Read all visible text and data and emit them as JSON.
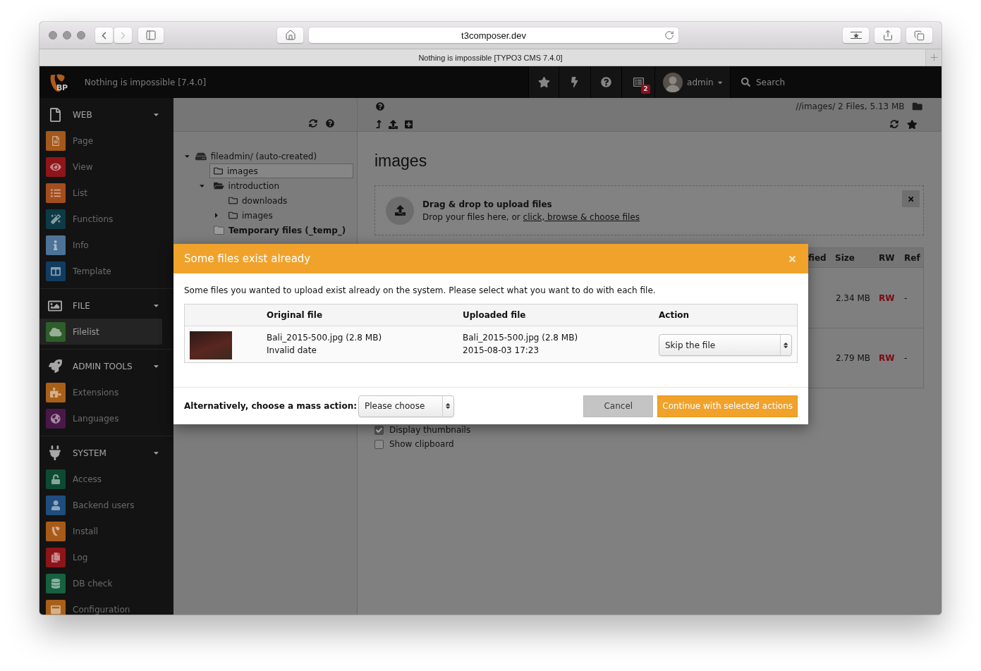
{
  "browser": {
    "navigation": [
      {
        "kind": "back",
        "disabled": false
      },
      {
        "kind": "forward",
        "disabled": true
      }
    ],
    "url": "t3composer.dev",
    "tab_title": "Nothing is impossible [TYPO3 CMS 7.4.0]"
  },
  "topbar": {
    "logo_text": "BP",
    "site_title": "Nothing is impossible [7.4.0]",
    "notification_count": "2",
    "user": "admin",
    "search": {
      "placeholder": "Search"
    }
  },
  "sidebar": {
    "groups": [
      {
        "title": "WEB",
        "expanded": true,
        "items": [
          {
            "label": "Page",
            "color": "#a4581c",
            "selected": false
          },
          {
            "label": "View",
            "color": "#8e1519",
            "selected": false
          },
          {
            "label": "List",
            "color": "#a24e1e",
            "selected": false
          },
          {
            "label": "Functions",
            "color": "#0c3b45",
            "selected": false
          },
          {
            "label": "Info",
            "color": "#4d7396",
            "selected": false
          },
          {
            "label": "Template",
            "color": "#113c60",
            "selected": false
          }
        ]
      },
      {
        "title": "FILE",
        "expanded": true,
        "items": [
          {
            "label": "Filelist",
            "color": "#2e5e2a",
            "selected": true
          }
        ]
      },
      {
        "title": "ADMIN TOOLS",
        "expanded": true,
        "items": [
          {
            "label": "Extensions",
            "color": "#a86018",
            "selected": false
          },
          {
            "label": "Languages",
            "color": "#4a1848",
            "selected": false
          }
        ]
      },
      {
        "title": "SYSTEM",
        "expanded": true,
        "items": [
          {
            "label": "Access",
            "color": "#0e4a32",
            "selected": false
          },
          {
            "label": "Backend users",
            "color": "#1f4d7d",
            "selected": false
          },
          {
            "label": "Install",
            "color": "#a85a18",
            "selected": false
          },
          {
            "label": "Log",
            "color": "#8e1418",
            "selected": false
          },
          {
            "label": "DB check",
            "color": "#176040",
            "selected": false
          },
          {
            "label": "Configuration",
            "color": "#a86018",
            "selected": false
          }
        ]
      }
    ]
  },
  "folder_tree": {
    "nodes": [
      {
        "label": "fileadmin/ (auto-created)",
        "kind": "storage",
        "expanded": true,
        "selected": false,
        "children": [
          {
            "label": "images",
            "kind": "folder",
            "selected": true
          },
          {
            "label": "introduction",
            "kind": "folder",
            "expanded": true,
            "selected": false,
            "children": [
              {
                "label": "downloads",
                "kind": "folder",
                "selected": false
              },
              {
                "label": "images",
                "kind": "folder",
                "expanded": false,
                "selected": false
              }
            ]
          },
          {
            "label": "Temporary files (_temp_)",
            "kind": "temporary",
            "selected": false
          }
        ]
      }
    ]
  },
  "docheader": {
    "path": "//images/ 2 Files, 5.13 MB"
  },
  "content": {
    "heading": "images",
    "dropzone": {
      "title": "Drag & drop to upload files",
      "text": "Drop your files here, or",
      "link": "click, browse & choose files"
    },
    "file_table": {
      "columns": [
        "fied",
        "Size",
        "RW",
        "Ref"
      ],
      "rows": [
        {
          "size": "2.34 MB",
          "rw": "RW",
          "ref": "-"
        },
        {
          "size": "2.79 MB",
          "rw": "RW",
          "ref": "-"
        }
      ]
    },
    "options": [
      {
        "label": "Display thumbnails",
        "checked": true
      },
      {
        "label": "Show clipboard",
        "checked": false
      }
    ]
  },
  "modal": {
    "title": "Some files exist already",
    "message": "Some files you wanted to upload exist already on the system. Please select what you want to do with each file.",
    "columns": [
      "Original file",
      "Uploaded file",
      "Action"
    ],
    "rows": [
      {
        "original": {
          "name": "Bali_2015-500.jpg (2.8 MB)",
          "date": "Invalid date"
        },
        "uploaded": {
          "name": "Bali_2015-500.jpg (2.8 MB)",
          "date": "2015-08-03 17:23"
        },
        "action": "Skip the file"
      }
    ],
    "mass_action": {
      "label": "Alternatively, choose a mass action:",
      "value": "Please choose"
    },
    "buttons": [
      {
        "label": "Cancel",
        "kind": "default"
      },
      {
        "label": "Continue with selected actions",
        "kind": "primary"
      }
    ]
  }
}
